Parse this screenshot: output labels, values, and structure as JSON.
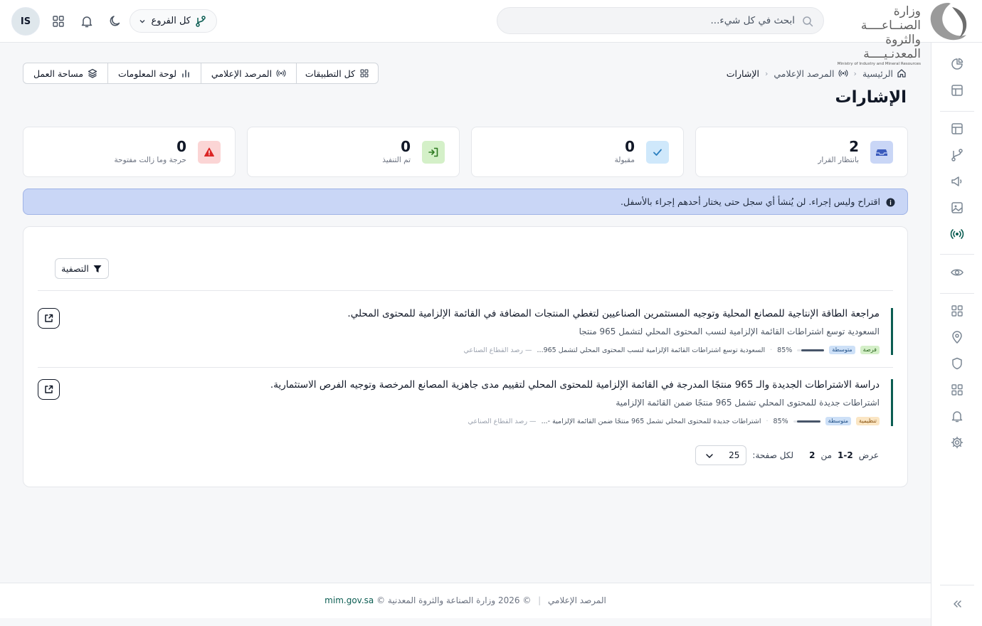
{
  "header": {
    "logo": {
      "line1": "وزارة الصنــاعــــة",
      "line2": "والثروة المعدنـيــــة",
      "english": "Ministry of Industry and Mineral Resources"
    },
    "search_placeholder": "ابحث في كل شيء...",
    "branch_label": "كل الفروع",
    "avatar_initials": "IS"
  },
  "breadcrumbs": {
    "home": "الرئيسية",
    "parent": "المرصد الإعلامي",
    "current": "الإشارات"
  },
  "page_title": "الإشارات",
  "tabs": [
    {
      "label": "كل التطبيقات",
      "icon": "grid-icon"
    },
    {
      "label": "المرصد الإعلامي",
      "icon": "broadcast-icon"
    },
    {
      "label": "لوحة المعلومات",
      "icon": "bar-chart-icon"
    },
    {
      "label": "مساحة العمل",
      "icon": "layers-icon"
    }
  ],
  "stats": [
    {
      "value": "2",
      "label": "بانتظار القرار",
      "icon": "inbox-icon",
      "color": "#3b5bbd",
      "bg": "#c9d6f6"
    },
    {
      "value": "0",
      "label": "مقبولة",
      "icon": "check-icon",
      "color": "#2b7fbf",
      "bg": "#cfe8fb"
    },
    {
      "value": "0",
      "label": "تم التنفيذ",
      "icon": "sign-in-icon",
      "color": "#2f7a22",
      "bg": "#d4f0c8"
    },
    {
      "value": "0",
      "label": "حرجة وما زالت مفتوحة",
      "icon": "warning-icon",
      "color": "#dc2626",
      "bg": "#fbd5d5"
    }
  ],
  "banner": {
    "text": "اقتراح وليس إجراء. لن يُنشأ أي سجل حتى يختار أحدهم إجراء بالأسفل."
  },
  "filter": {
    "label": "التصفية"
  },
  "signals": [
    {
      "title": "مراجعة الطاقة الإنتاجية للمصانع المحلية وتوجيه المستثمرين الصناعيين لتغطي المنتجات المضافة في القائمة الإلزامية للمحتوى المحلي.",
      "subtitle": "السعودية توسع اشتراطات القائمة الإلزامية لنسب المحتوى المحلي لتشمل 965 منتجا",
      "type_tag": "فرصة",
      "priority_tag": "متوسطة",
      "confidence": 0.85,
      "confidence_label": "85%",
      "source_excerpt": "السعودية توسع اشتراطات القائمة الإلزامية لنسب المحتوى المحلي لتشمل 965...",
      "source": "— رصد القطاع الصناعي"
    },
    {
      "title": "دراسة الاشتراطات الجديدة والـ 965 منتجًا المدرجة في القائمة الإلزامية للمحتوى المحلي لتقييم مدى جاهزية المصانع المرخصة وتوجيه الفرص الاستثمارية.",
      "subtitle": "اشتراطات جديدة للمحتوى المحلي تشمل 965 منتجًا ضمن القائمة الإلزامية",
      "type_tag": "تنظيمية",
      "priority_tag": "متوسطة",
      "confidence": 0.85,
      "confidence_label": "85%",
      "source_excerpt": "اشتراطات جديدة للمحتوى المحلي تشمل 965 منتجًا ضمن القائمة الإلزامية -...",
      "source": "— رصد القطاع الصناعي"
    }
  ],
  "pagination": {
    "showing_prefix": "عرض",
    "range": "1-2",
    "of_word": "من",
    "total": "2",
    "per_page_label": "لكل صفحة:",
    "per_page_value": "25"
  },
  "footer": {
    "app_name": "المرصد الإعلامي",
    "copyright": "© 2026 وزارة الصناعة والثروة المعدنية ©",
    "site": "mim.gov.sa"
  },
  "sidebar_icons": [
    "pie-chart-icon",
    "layout-icon",
    "layout-icon",
    "branch-icon",
    "megaphone-icon",
    "image-icon",
    "broadcast-icon",
    "eye-icon",
    "grid-icon",
    "map-pin-icon",
    "shield-icon",
    "grid-icon",
    "bell-icon",
    "gear-icon",
    "collapse-icon"
  ],
  "colors": {
    "accent": "#0b5d52",
    "banner_bg": "#c9d6f6"
  }
}
